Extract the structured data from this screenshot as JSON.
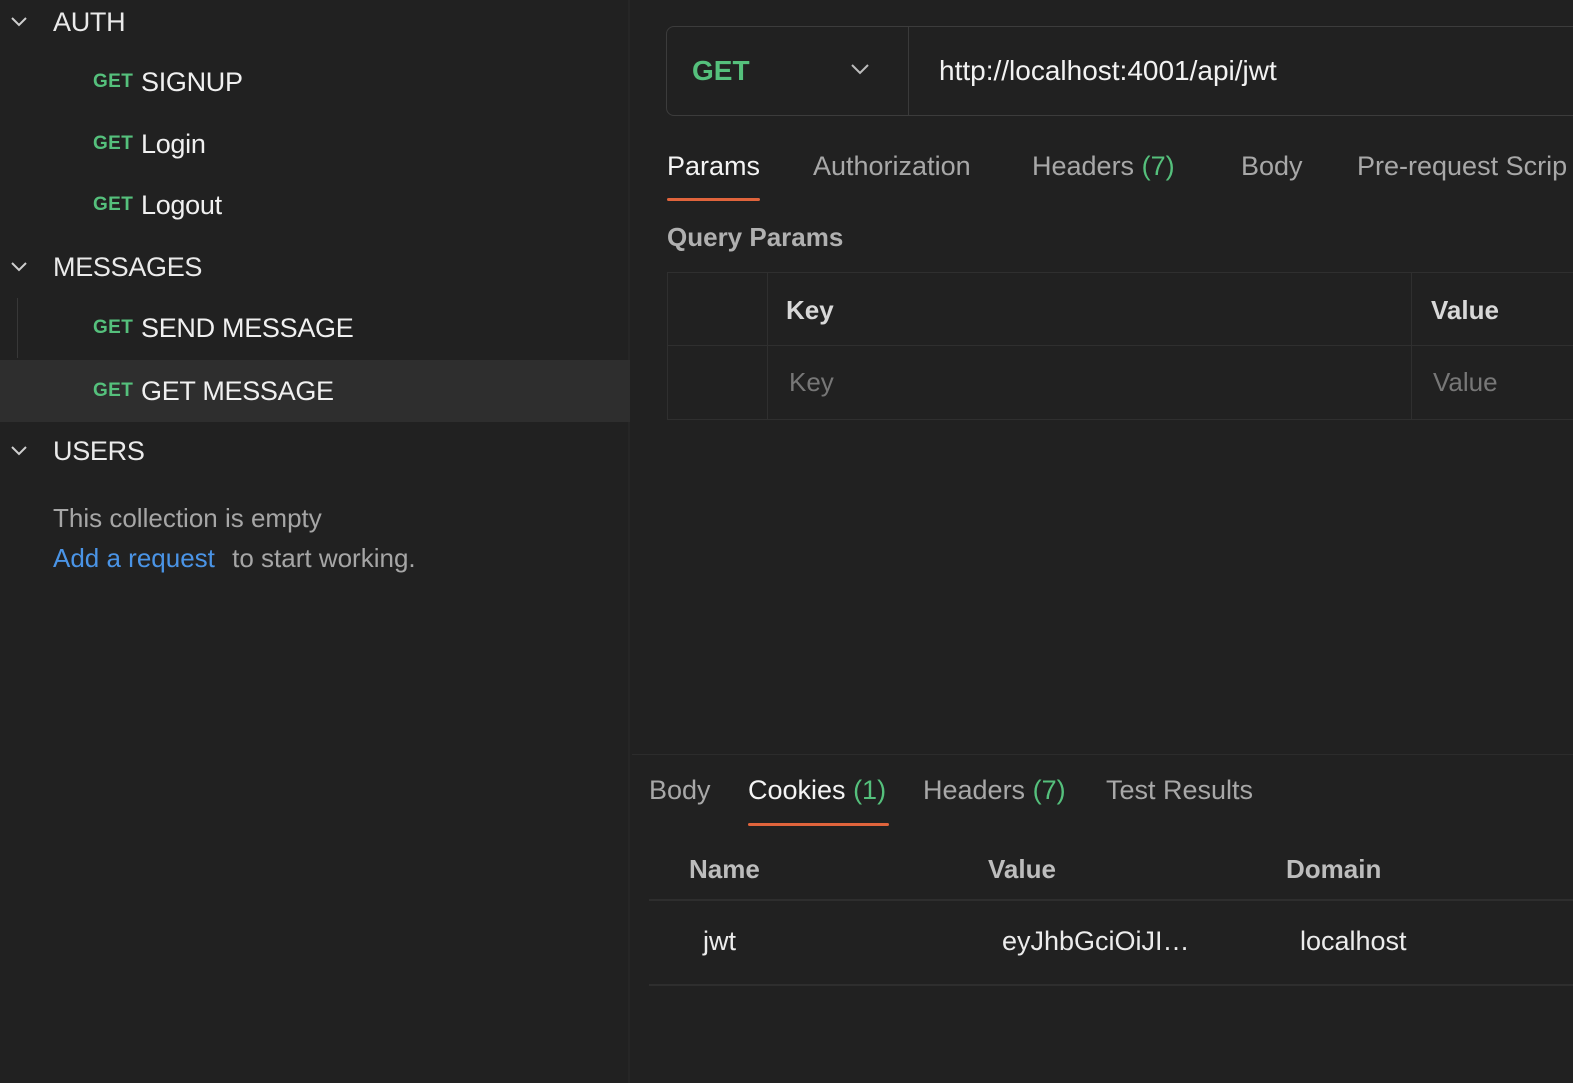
{
  "sidebar": {
    "folders": [
      {
        "label": "AUTH",
        "requests": [
          {
            "method": "GET",
            "label": "SIGNUP"
          },
          {
            "method": "GET",
            "label": "Login"
          },
          {
            "method": "GET",
            "label": "Logout"
          }
        ]
      },
      {
        "label": "MESSAGES",
        "requests": [
          {
            "method": "GET",
            "label": "SEND MESSAGE"
          },
          {
            "method": "GET",
            "label": "GET MESSAGE",
            "selected": true
          }
        ]
      },
      {
        "label": "USERS",
        "empty_text": "This collection is empty",
        "add_link": "Add a request",
        "add_suffix": "to start working."
      }
    ]
  },
  "request": {
    "method": "GET",
    "url": "http://localhost:4001/api/jwt",
    "tabs": [
      {
        "label": "Params",
        "count": ""
      },
      {
        "label": "Authorization",
        "count": ""
      },
      {
        "label": "Headers",
        "count": "(7)"
      },
      {
        "label": "Body",
        "count": ""
      },
      {
        "label": "Pre-request Scrip",
        "count": ""
      }
    ],
    "active_tab": "Params",
    "query_params": {
      "title": "Query Params",
      "headers": [
        "Key",
        "Value"
      ],
      "placeholders": [
        "Key",
        "Value"
      ]
    }
  },
  "response": {
    "tabs": [
      {
        "label": "Body",
        "count": ""
      },
      {
        "label": "Cookies",
        "count": "(1)"
      },
      {
        "label": "Headers",
        "count": "(7)"
      },
      {
        "label": "Test Results",
        "count": ""
      }
    ],
    "active_tab": "Cookies",
    "cookies": {
      "headers": [
        "Name",
        "Value",
        "Domain"
      ],
      "rows": [
        [
          "jwt",
          "eyJhbGciOiJI…",
          "localhost"
        ]
      ]
    }
  },
  "colors": {
    "background": "#212121",
    "get_method": "#55c07c",
    "accent_underline": "#e0643c",
    "link": "#4a94e6",
    "selected_row": "#2e2e2e"
  }
}
